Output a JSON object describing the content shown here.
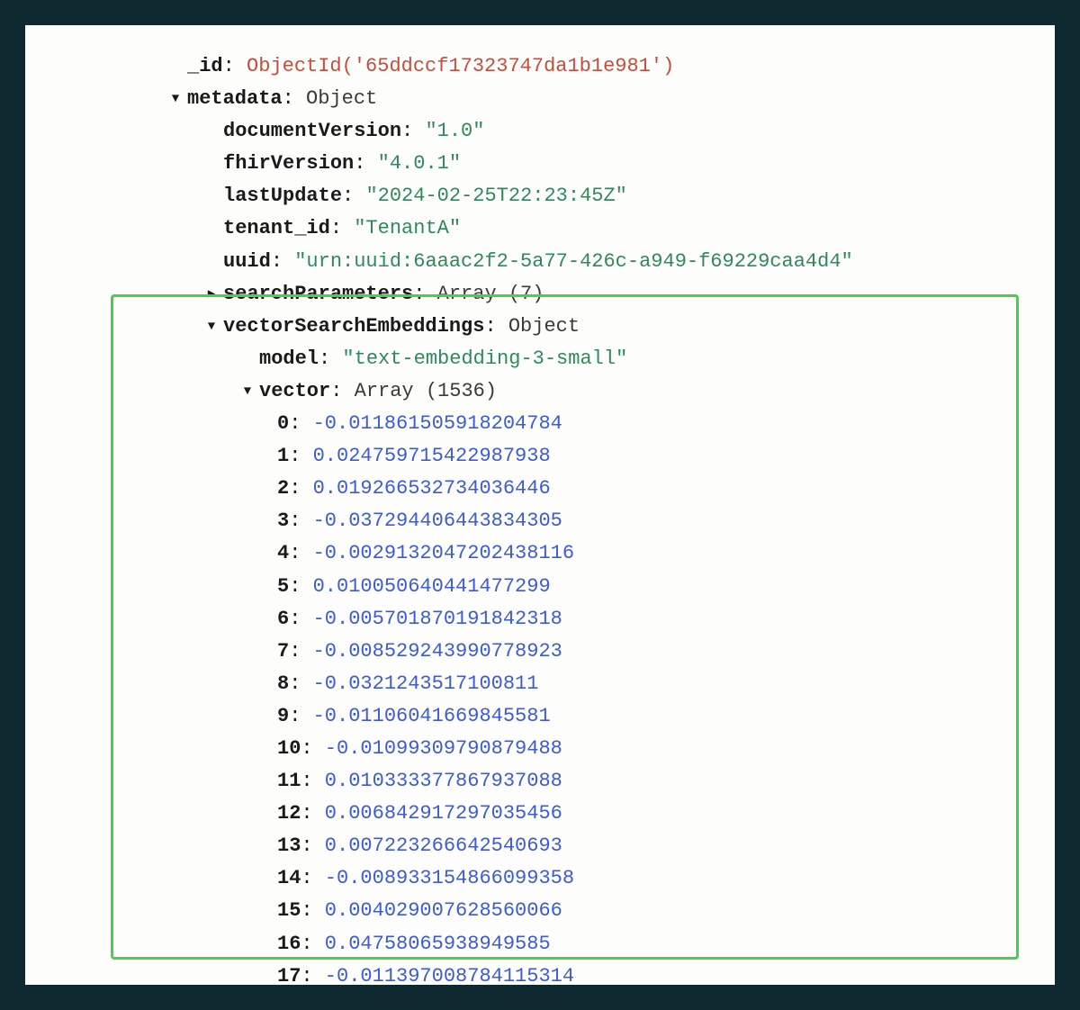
{
  "caret_open": "▼",
  "caret_closed": "▶",
  "doc": {
    "id": {
      "key": "_id",
      "value": "ObjectId('65ddccf17323747da1b1e981')"
    },
    "metadata": {
      "key": "metadata",
      "type": "Object",
      "documentVersion": {
        "key": "documentVersion",
        "value": "\"1.0\""
      },
      "fhirVersion": {
        "key": "fhirVersion",
        "value": "\"4.0.1\""
      },
      "lastUpdate": {
        "key": "lastUpdate",
        "value": "\"2024-02-25T22:23:45Z\""
      },
      "tenant_id": {
        "key": "tenant_id",
        "value": "\"TenantA\""
      },
      "uuid": {
        "key": "uuid",
        "value": "\"urn:uuid:6aaac2f2-5a77-426c-a949-f69229caa4d4\""
      },
      "searchParameters": {
        "key": "searchParameters",
        "type": "Array (7)"
      },
      "vectorSearchEmbeddings": {
        "key": "vectorSearchEmbeddings",
        "type": "Object",
        "model": {
          "key": "model",
          "value": "\"text-embedding-3-small\""
        },
        "vector": {
          "key": "vector",
          "type": "Array (1536)",
          "values": [
            "-0.011861505918204784",
            "0.024759715422987938",
            "0.019266532734036446",
            "-0.037294406443834305",
            "-0.0029132047202438116",
            "0.010050640441477299",
            "-0.005701870191842318",
            "-0.008529243990778923",
            "-0.0321243517100811",
            "-0.01106041669845581",
            "-0.01099309790879488",
            "0.010333377867937088",
            "0.006842917297035456",
            "0.007223266642540693",
            "-0.008933154866099358",
            "0.004029007628560066",
            "0.04758065938949585",
            "-0.011397008784115314"
          ]
        }
      }
    }
  }
}
